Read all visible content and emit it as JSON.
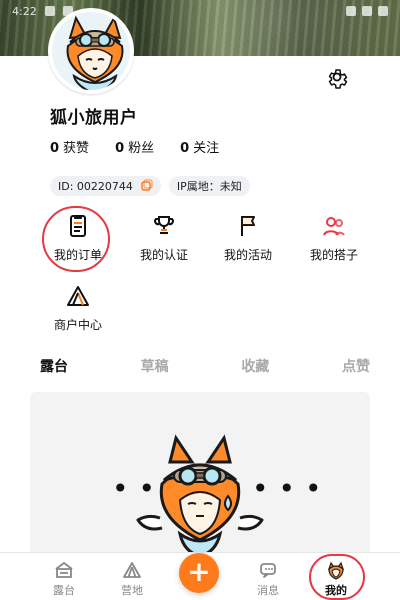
{
  "status_bar": {
    "time": "4:22"
  },
  "profile": {
    "username": "狐小旅用户",
    "stats": [
      {
        "value": "0",
        "label": "获赞"
      },
      {
        "value": "0",
        "label": "粉丝"
      },
      {
        "value": "0",
        "label": "关注"
      }
    ],
    "badges": {
      "id_text": "ID: 00220744",
      "ip_text": "IP属地：未知"
    },
    "settings_icon": "gear-icon"
  },
  "quick_actions": [
    {
      "label": "我的订单",
      "icon": "order-icon"
    },
    {
      "label": "我的认证",
      "icon": "trophy-icon"
    },
    {
      "label": "我的活动",
      "icon": "flag-icon"
    },
    {
      "label": "我的搭子",
      "icon": "users-icon"
    },
    {
      "label": "商户中心",
      "icon": "merchant-icon"
    }
  ],
  "tabs": [
    {
      "label": "露台",
      "active": true
    },
    {
      "label": "草稿",
      "active": false
    },
    {
      "label": "收藏",
      "active": false
    },
    {
      "label": "点赞",
      "active": false
    }
  ],
  "empty_state": {
    "illustration": "fox-illustration"
  },
  "bottom_nav": [
    {
      "label": "露台",
      "icon": "camp-icon",
      "active": false
    },
    {
      "label": "营地",
      "icon": "tent-icon",
      "active": false
    },
    {
      "label": "消息",
      "icon": "message-icon",
      "active": false
    },
    {
      "label": "我的",
      "icon": "profile-fox-icon",
      "active": true
    }
  ],
  "colors": {
    "accent_orange": "#ff7a1a",
    "highlight_red": "#e53945",
    "badge_bg": "#f0f1f4"
  }
}
